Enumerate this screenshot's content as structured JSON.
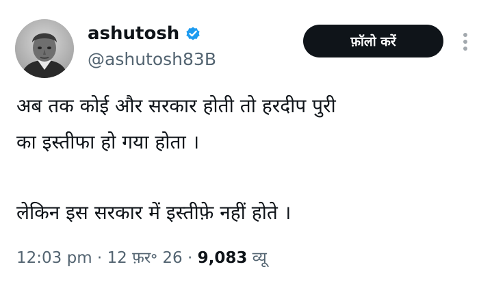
{
  "author": {
    "display_name": "ashutosh",
    "handle": "@ashutosh83B",
    "verified": true,
    "verified_color": "#1d9bf0"
  },
  "actions": {
    "follow_label": "फ़ॉलो करें",
    "more_icon": "vertical-ellipsis-icon"
  },
  "tweet": {
    "lines": [
      "अब तक कोई और सरकार होती तो हरदीप पुरी",
      "का इस्तीफा हो गया होता ।",
      "लेकिन इस सरकार में इस्तीफ़े नहीं होते ।"
    ]
  },
  "meta": {
    "time": "12:03 pm",
    "date": "12 फ़र॰ 26",
    "separator": "·",
    "views_count": "9,083",
    "views_label": "व्यू"
  }
}
